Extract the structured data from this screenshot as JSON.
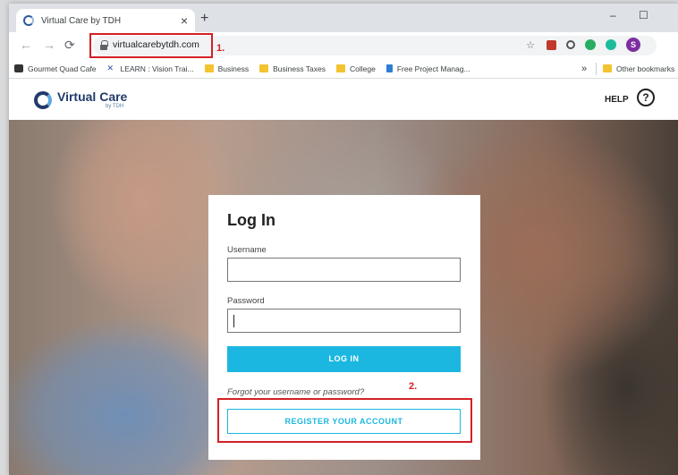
{
  "browser": {
    "tab_title": "Virtual Care by TDH",
    "tab_close": "×",
    "new_tab": "+",
    "url": "virtualcarebytdh.com",
    "profile_initial": "S",
    "window_controls": [
      "–",
      "☐"
    ]
  },
  "annotations": {
    "step1": "1.",
    "step2": "2.",
    "color": "#d32027"
  },
  "bookmarks": [
    {
      "label": "Gourmet Quad Cafe",
      "icon": "cup-icon"
    },
    {
      "label": "LEARN : Vision Trai...",
      "icon": "learn-icon"
    },
    {
      "label": "Business",
      "icon": "folder-icon"
    },
    {
      "label": "Business Taxes",
      "icon": "folder-icon"
    },
    {
      "label": "College",
      "icon": "folder-icon"
    },
    {
      "label": "Free Project Manag...",
      "icon": "page-icon"
    }
  ],
  "bookmarks_overflow": "»",
  "bookmarks_other": "Other bookmarks",
  "site": {
    "logo_text": "Virtual Care",
    "logo_sub": "by TDH",
    "help": "HELP",
    "help_icon": "?"
  },
  "login": {
    "title": "Log In",
    "username_label": "Username",
    "username_value": "",
    "password_label": "Password",
    "password_value": "",
    "login_button": "LOG IN",
    "forgot_link": "Forgot your username or password?",
    "register_button": "REGISTER YOUR ACCOUNT",
    "accent": "#1bb7e0"
  }
}
